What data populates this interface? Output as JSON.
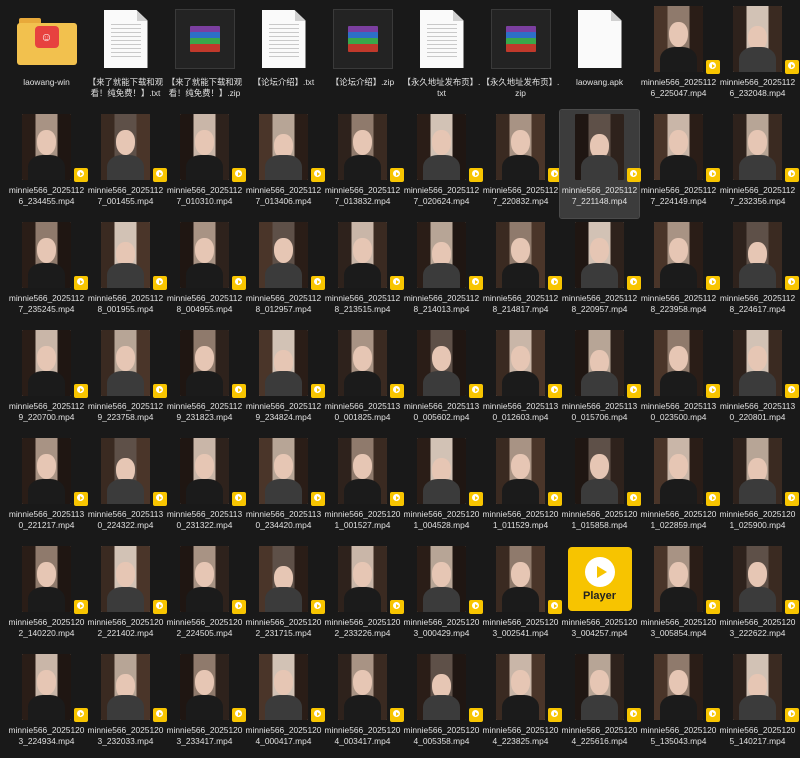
{
  "colors": {
    "background": "#191919",
    "text": "#e0e0e0",
    "selected": "#3c3c3c",
    "player_yellow": "#f7c400",
    "folder": "#f2c14e"
  },
  "items": [
    {
      "type": "folder",
      "label": "laowang-win",
      "icon": "folder-icon"
    },
    {
      "type": "txt",
      "label": "【来了就能下载和观看！纯免费！】.txt",
      "icon": "text-file-icon"
    },
    {
      "type": "zip",
      "label": "【来了就能下载和观看！纯免费！】.zip",
      "icon": "winrar-archive-icon"
    },
    {
      "type": "txt",
      "label": "【论坛介绍】.txt",
      "icon": "text-file-icon"
    },
    {
      "type": "zip",
      "label": "【论坛介绍】.zip",
      "icon": "winrar-archive-icon"
    },
    {
      "type": "txt",
      "label": "【永久地址发布页】.txt",
      "icon": "text-file-icon"
    },
    {
      "type": "zip",
      "label": "【永久地址发布页】.zip",
      "icon": "winrar-archive-icon"
    },
    {
      "type": "apk",
      "label": "laowang.apk",
      "icon": "apk-file-icon"
    },
    {
      "type": "video",
      "label": "minnie566_20251126_225047.mp4"
    },
    {
      "type": "video",
      "label": "minnie566_20251126_232048.mp4"
    },
    {
      "type": "video",
      "label": "minnie566_20251126_234455.mp4"
    },
    {
      "type": "video",
      "label": "minnie566_20251127_001455.mp4"
    },
    {
      "type": "video",
      "label": "minnie566_20251127_010310.mp4"
    },
    {
      "type": "video",
      "label": "minnie566_20251127_013406.mp4"
    },
    {
      "type": "video",
      "label": "minnie566_20251127_013832.mp4"
    },
    {
      "type": "video",
      "label": "minnie566_20251127_020624.mp4"
    },
    {
      "type": "video",
      "label": "minnie566_20251127_220832.mp4"
    },
    {
      "type": "video",
      "label": "minnie566_20251127_221148.mp4",
      "selected": true
    },
    {
      "type": "video",
      "label": "minnie566_20251127_224149.mp4"
    },
    {
      "type": "video",
      "label": "minnie566_20251127_232356.mp4"
    },
    {
      "type": "video",
      "label": "minnie566_20251127_235245.mp4"
    },
    {
      "type": "video",
      "label": "minnie566_20251128_001955.mp4"
    },
    {
      "type": "video",
      "label": "minnie566_20251128_004955.mp4"
    },
    {
      "type": "video",
      "label": "minnie566_20251128_012957.mp4"
    },
    {
      "type": "video",
      "label": "minnie566_20251128_213515.mp4"
    },
    {
      "type": "video",
      "label": "minnie566_20251128_214013.mp4"
    },
    {
      "type": "video",
      "label": "minnie566_20251128_214817.mp4"
    },
    {
      "type": "video",
      "label": "minnie566_20251128_220957.mp4"
    },
    {
      "type": "video",
      "label": "minnie566_20251128_223958.mp4"
    },
    {
      "type": "video",
      "label": "minnie566_20251128_224617.mp4"
    },
    {
      "type": "video",
      "label": "minnie566_20251129_220700.mp4"
    },
    {
      "type": "video",
      "label": "minnie566_20251129_223758.mp4"
    },
    {
      "type": "video",
      "label": "minnie566_20251129_231823.mp4"
    },
    {
      "type": "video",
      "label": "minnie566_20251129_234824.mp4"
    },
    {
      "type": "video",
      "label": "minnie566_20251130_001825.mp4"
    },
    {
      "type": "video",
      "label": "minnie566_20251130_005602.mp4"
    },
    {
      "type": "video",
      "label": "minnie566_20251130_012603.mp4"
    },
    {
      "type": "video",
      "label": "minnie566_20251130_015706.mp4"
    },
    {
      "type": "video",
      "label": "minnie566_20251130_023500.mp4"
    },
    {
      "type": "video",
      "label": "minnie566_20251130_220801.mp4"
    },
    {
      "type": "video",
      "label": "minnie566_20251130_221217.mp4"
    },
    {
      "type": "video",
      "label": "minnie566_20251130_224322.mp4"
    },
    {
      "type": "video",
      "label": "minnie566_20251130_231322.mp4"
    },
    {
      "type": "video",
      "label": "minnie566_20251130_234420.mp4"
    },
    {
      "type": "video",
      "label": "minnie566_20251201_001527.mp4"
    },
    {
      "type": "video",
      "label": "minnie566_20251201_004528.mp4"
    },
    {
      "type": "video",
      "label": "minnie566_20251201_011529.mp4"
    },
    {
      "type": "video",
      "label": "minnie566_20251201_015858.mp4"
    },
    {
      "type": "video",
      "label": "minnie566_20251201_022859.mp4"
    },
    {
      "type": "video",
      "label": "minnie566_20251201_025900.mp4"
    },
    {
      "type": "video",
      "label": "minnie566_20251202_140220.mp4"
    },
    {
      "type": "video",
      "label": "minnie566_20251202_221402.mp4"
    },
    {
      "type": "video",
      "label": "minnie566_20251202_224505.mp4"
    },
    {
      "type": "video",
      "label": "minnie566_20251202_231715.mp4"
    },
    {
      "type": "video",
      "label": "minnie566_20251202_233226.mp4"
    },
    {
      "type": "video",
      "label": "minnie566_20251203_000429.mp4"
    },
    {
      "type": "video",
      "label": "minnie566_20251203_002541.mp4"
    },
    {
      "type": "player",
      "label": "minnie566_20251203_004257.mp4",
      "player_text": "Player"
    },
    {
      "type": "video",
      "label": "minnie566_20251203_005854.mp4"
    },
    {
      "type": "video",
      "label": "minnie566_20251203_222622.mp4"
    },
    {
      "type": "video",
      "label": "minnie566_20251203_224934.mp4"
    },
    {
      "type": "video",
      "label": "minnie566_20251203_232033.mp4"
    },
    {
      "type": "video",
      "label": "minnie566_20251203_233417.mp4"
    },
    {
      "type": "video",
      "label": "minnie566_20251204_000417.mp4"
    },
    {
      "type": "video",
      "label": "minnie566_20251204_003417.mp4"
    },
    {
      "type": "video",
      "label": "minnie566_20251204_005358.mp4"
    },
    {
      "type": "video",
      "label": "minnie566_20251204_223825.mp4"
    },
    {
      "type": "video",
      "label": "minnie566_20251204_225616.mp4"
    },
    {
      "type": "video",
      "label": "minnie566_20251205_135043.mp4"
    },
    {
      "type": "video",
      "label": "minnie566_20251205_140217.mp4"
    }
  ]
}
